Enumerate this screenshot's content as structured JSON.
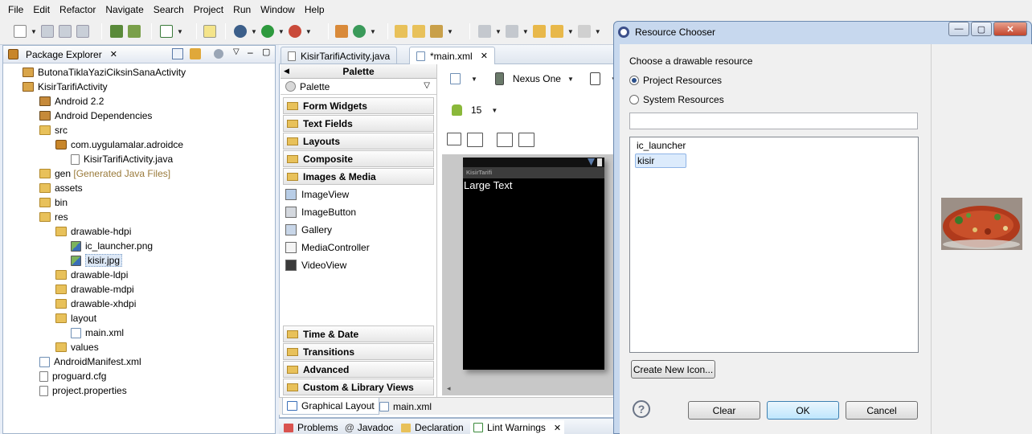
{
  "menu": [
    "File",
    "Edit",
    "Refactor",
    "Navigate",
    "Search",
    "Project",
    "Run",
    "Window",
    "Help"
  ],
  "package_explorer": {
    "title": "Package Explorer",
    "items": [
      {
        "label": "ButonaTiklaYaziCiksinSanaActivity",
        "icon": "project-icon"
      },
      {
        "label": "KisirTarifiActivity",
        "icon": "project-icon"
      },
      {
        "label": "Android 2.2",
        "icon": "library-icon"
      },
      {
        "label": "Android Dependencies",
        "icon": "library-icon"
      },
      {
        "label": "src",
        "icon": "source-folder-icon"
      },
      {
        "label": "com.uygulamalar.adroidce",
        "icon": "package-icon"
      },
      {
        "label": "KisirTarifiActivity.java",
        "icon": "java-file-icon"
      },
      {
        "label": "gen",
        "icon": "source-folder-icon",
        "suffix": "[Generated Java Files]"
      },
      {
        "label": "assets",
        "icon": "folder-icon"
      },
      {
        "label": "bin",
        "icon": "folder-icon"
      },
      {
        "label": "res",
        "icon": "folder-icon"
      },
      {
        "label": "drawable-hdpi",
        "icon": "folder-icon"
      },
      {
        "label": "ic_launcher.png",
        "icon": "image-file-icon"
      },
      {
        "label": "kisir.jpg",
        "icon": "image-file-icon"
      },
      {
        "label": "drawable-ldpi",
        "icon": "folder-icon"
      },
      {
        "label": "drawable-mdpi",
        "icon": "folder-icon"
      },
      {
        "label": "drawable-xhdpi",
        "icon": "folder-icon"
      },
      {
        "label": "layout",
        "icon": "folder-icon"
      },
      {
        "label": "main.xml",
        "icon": "xml-file-icon"
      },
      {
        "label": "values",
        "icon": "folder-icon"
      },
      {
        "label": "AndroidManifest.xml",
        "icon": "xml-file-icon"
      },
      {
        "label": "proguard.cfg",
        "icon": "file-icon"
      },
      {
        "label": "project.properties",
        "icon": "file-icon"
      }
    ]
  },
  "editor": {
    "tabs": [
      "KisirTarifiActivity.java",
      "*main.xml"
    ],
    "device": "Nexus One",
    "api_level": "15",
    "bottom_tabs": [
      "Graphical Layout",
      "main.xml"
    ],
    "device_title": "KisirTarifi",
    "device_text": "Large Text"
  },
  "palette": {
    "title": "Palette",
    "selector": "Palette",
    "categories_top": [
      "Form Widgets",
      "Text Fields",
      "Layouts",
      "Composite",
      "Images & Media"
    ],
    "media_items": [
      "ImageView",
      "ImageButton",
      "Gallery",
      "MediaController",
      "VideoView"
    ],
    "categories_bottom": [
      "Time & Date",
      "Transitions",
      "Advanced",
      "Custom & Library Views"
    ]
  },
  "bottom_panel": {
    "tabs": [
      "Problems",
      "Javadoc",
      "Declaration",
      "Lint Warnings"
    ]
  },
  "dialog": {
    "title": "Resource Chooser",
    "prompt": "Choose a drawable resource",
    "radio_project": "Project Resources",
    "radio_system": "System Resources",
    "selected_radio": "Project Resources",
    "filter_value": "",
    "resources": [
      "ic_launcher",
      "kisir"
    ],
    "selected_resource": "kisir",
    "create_button": "Create New Icon...",
    "clear_button": "Clear",
    "ok_button": "OK",
    "cancel_button": "Cancel",
    "help_glyph": "?",
    "window_buttons": [
      "—",
      "▢",
      "✕"
    ]
  }
}
